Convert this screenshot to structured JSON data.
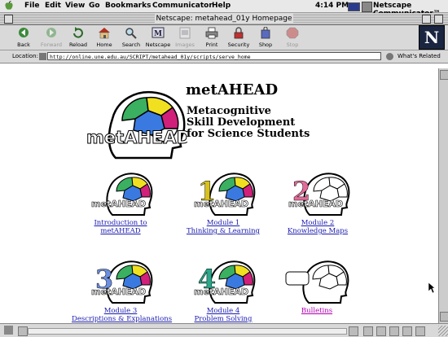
{
  "menubar": {
    "items": [
      "File",
      "Edit",
      "View",
      "Go",
      "Bookmarks",
      "Communicator",
      "Help"
    ],
    "clock": "4:14 PM",
    "app_name": "Netscape Communicator™"
  },
  "window": {
    "title": "Netscape: metahead_01y Homepage"
  },
  "toolbar": {
    "buttons": [
      {
        "label": "Back",
        "icon": "back-arrow-icon",
        "enabled": true
      },
      {
        "label": "Forward",
        "icon": "forward-arrow-icon",
        "enabled": false
      },
      {
        "label": "Reload",
        "icon": "reload-icon",
        "enabled": true
      },
      {
        "label": "Home",
        "icon": "home-icon",
        "enabled": true
      },
      {
        "label": "Search",
        "icon": "search-icon",
        "enabled": true
      },
      {
        "label": "Netscape",
        "icon": "netscape-icon",
        "enabled": true
      },
      {
        "label": "Images",
        "icon": "images-icon",
        "enabled": false
      },
      {
        "label": "Print",
        "icon": "print-icon",
        "enabled": true
      },
      {
        "label": "Security",
        "icon": "security-lock-icon",
        "enabled": true
      },
      {
        "label": "Shop",
        "icon": "shop-bag-icon",
        "enabled": true
      },
      {
        "label": "Stop",
        "icon": "stop-icon",
        "enabled": false
      }
    ],
    "logo_letter": "N"
  },
  "location": {
    "label": "Location:",
    "url": "http://online.une.edu.au/SCRIPT/metahead_01y/scripts/serve_home",
    "whats_related": "What's Related"
  },
  "page": {
    "brand": "metAHEAD",
    "subtitle_lines": [
      "Metacognitive",
      "Skill Development",
      "for Science Students"
    ],
    "logo_text": "metAHEAD",
    "modules": [
      {
        "numeral": "",
        "numeral_color": "#000000",
        "link_lines": [
          "Introduction to",
          "metAHEAD"
        ],
        "visited": false,
        "icon": "head-logo-icon"
      },
      {
        "numeral": "1",
        "numeral_color": "#d8c21a",
        "link_lines": [
          "Module 1",
          "Thinking & Learning"
        ],
        "visited": false,
        "icon": "module-1-head-icon"
      },
      {
        "numeral": "2",
        "numeral_color": "#e46a9a",
        "link_lines": [
          "Module 2",
          "Knowledge Maps"
        ],
        "visited": false,
        "icon": "module-2-head-icon"
      },
      {
        "numeral": "3",
        "numeral_color": "#6a8ee0",
        "link_lines": [
          "Module 3",
          "Descriptions & Explanations"
        ],
        "visited": false,
        "icon": "module-3-head-icon"
      },
      {
        "numeral": "4",
        "numeral_color": "#2aa88a",
        "link_lines": [
          "Module 4",
          "Problem Solving"
        ],
        "visited": false,
        "icon": "module-4-head-icon"
      },
      {
        "numeral": "",
        "numeral_color": "#000000",
        "link_lines": [
          "Bulletins"
        ],
        "visited": true,
        "icon": "bulletins-head-icon"
      }
    ]
  },
  "colors": {
    "link": "#1a1ab0",
    "visited_link": "#b000b0",
    "brain_yellow": "#f0e020",
    "brain_blue": "#3a7ae0",
    "brain_green": "#3ab060",
    "brain_magenta": "#d0207a"
  }
}
